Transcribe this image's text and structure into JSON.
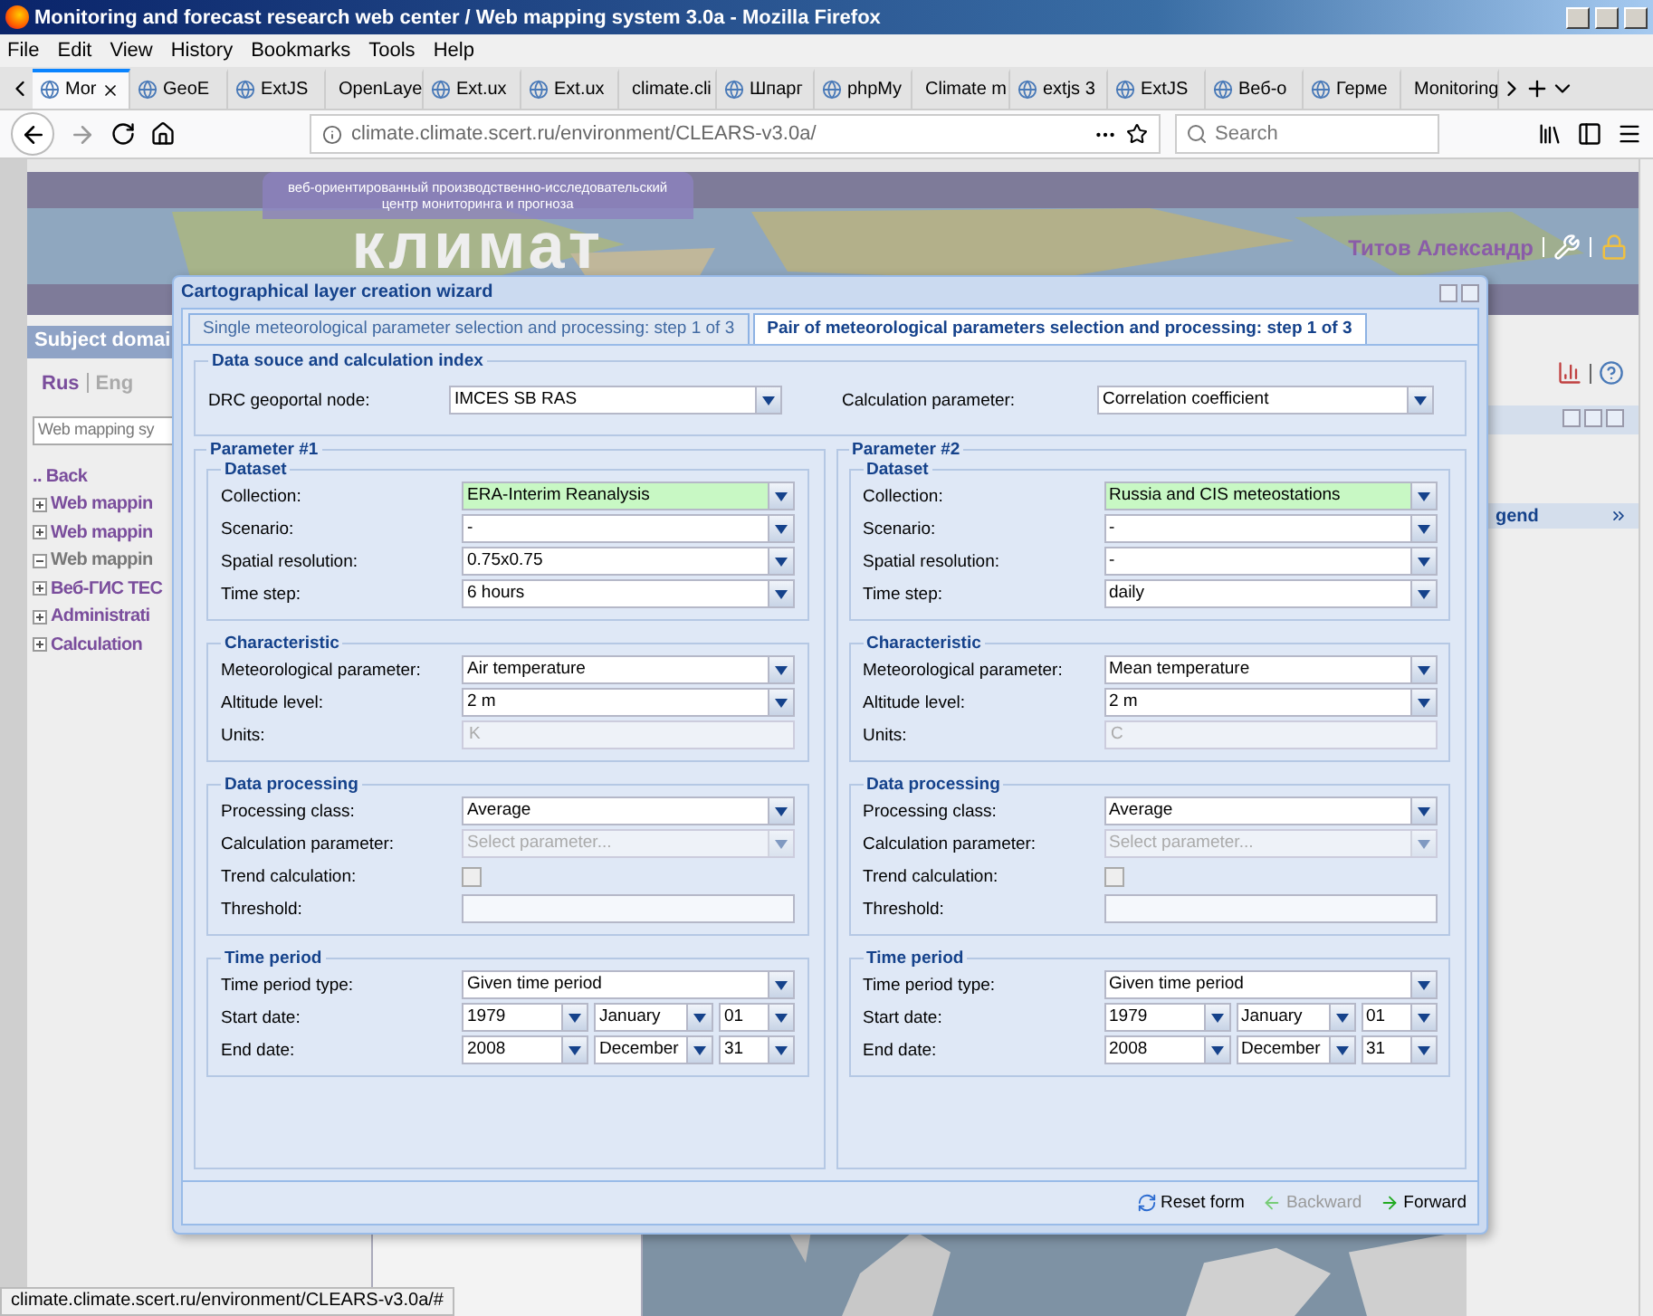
{
  "browser": {
    "title": "Monitoring and forecast research web center / Web mapping system 3.0a - Mozilla Firefox",
    "menu": [
      "File",
      "Edit",
      "View",
      "History",
      "Bookmarks",
      "Tools",
      "Help"
    ],
    "tabs": [
      {
        "label": "Mor",
        "selected": true
      },
      {
        "label": "GeoE",
        "selected": false
      },
      {
        "label": "ExtJS",
        "selected": false
      },
      {
        "label": "OpenLaye",
        "selected": false
      },
      {
        "label": "Ext.ux",
        "selected": false
      },
      {
        "label": "Ext.ux",
        "selected": false
      },
      {
        "label": "climate.cli",
        "selected": false
      },
      {
        "label": "Шпарг",
        "selected": false
      },
      {
        "label": "phpMy",
        "selected": false
      },
      {
        "label": "Climate m",
        "selected": false
      },
      {
        "label": "extjs 3",
        "selected": false
      },
      {
        "label": "ExtJS",
        "selected": false
      },
      {
        "label": "Веб-о",
        "selected": false
      },
      {
        "label": "Герме",
        "selected": false
      },
      {
        "label": "Monitoring",
        "selected": false
      }
    ],
    "url": "climate.climate.scert.ru/environment/CLEARS-v3.0a/",
    "search": {
      "placeholder": "Search"
    },
    "status": "climate.climate.scert.ru/environment/CLEARS-v3.0a/#"
  },
  "site": {
    "tagline": [
      "веб-ориентированный производственно-исследовательский",
      "центр мониторинга и прогноза"
    ],
    "logo": "климат",
    "user": "Титов Александр",
    "sidebar_title": "Subject domai",
    "languages": [
      {
        "label": "Rus",
        "selected": true
      },
      {
        "label": "Eng",
        "selected": false
      }
    ],
    "search_value": "Web mapping sy",
    "tree": [
      {
        "label": ".. Back",
        "kind": "back"
      },
      {
        "label": "Web mappin",
        "kind": "node",
        "expanded": false
      },
      {
        "label": "Web mappin",
        "kind": "node",
        "expanded": false
      },
      {
        "label": "Web mappin",
        "kind": "node",
        "expanded": true
      },
      {
        "label": "Веб-ГИС ТЕС",
        "kind": "node",
        "expanded": false
      },
      {
        "label": "Administrati",
        "kind": "node",
        "expanded": false
      },
      {
        "label": "Calculation",
        "kind": "node",
        "expanded": false
      }
    ],
    "legend_title": "gend"
  },
  "wizard": {
    "title": "Cartographical layer creation wizard",
    "tabs": [
      {
        "label": "Single meteorological parameter selection and processing: step 1 of 3",
        "selected": false
      },
      {
        "label": "Pair of meteorological parameters selection and processing: step 1 of 3",
        "selected": true
      }
    ],
    "source": {
      "title": "Data souce and calculation index",
      "fields": [
        {
          "label": "DRC geoportal node:",
          "value": "IMCES SB RAS"
        },
        {
          "label": "Calculation parameter:",
          "value": "Correlation coefficient"
        }
      ]
    },
    "parameters": [
      {
        "title": "Parameter #1",
        "sections": [
          {
            "title": "Dataset",
            "rows": [
              {
                "label": "Collection:",
                "kind": "select",
                "value": "ERA-Interim Reanalysis",
                "highlighted": true,
                "disabled": false
              },
              {
                "label": "Scenario:",
                "kind": "select",
                "value": "-",
                "highlighted": false,
                "disabled": false
              },
              {
                "label": "Spatial resolution:",
                "kind": "select",
                "value": "0.75x0.75",
                "highlighted": false,
                "disabled": false
              },
              {
                "label": "Time step:",
                "kind": "select",
                "value": "6 hours",
                "highlighted": false,
                "disabled": false
              }
            ]
          },
          {
            "title": "Characteristic",
            "rows": [
              {
                "label": "Meteorological parameter:",
                "kind": "select",
                "value": "Air temperature",
                "highlighted": false,
                "disabled": false
              },
              {
                "label": "Altitude level:",
                "kind": "select",
                "value": "2 m",
                "highlighted": false,
                "disabled": false
              },
              {
                "label": "Units:",
                "kind": "text",
                "value": "K",
                "disabled": true
              }
            ]
          },
          {
            "title": "Data processing",
            "rows": [
              {
                "label": "Processing class:",
                "kind": "select",
                "value": "Average",
                "highlighted": false,
                "disabled": false
              },
              {
                "label": "Calculation parameter:",
                "kind": "select",
                "placeholder": "Select parameter...",
                "highlighted": false,
                "disabled": true
              },
              {
                "label": "Trend calculation:",
                "kind": "checkbox",
                "checked": false
              },
              {
                "label": "Threshold:",
                "kind": "text",
                "disabled": false
              }
            ]
          },
          {
            "title": "Time period",
            "rows": [
              {
                "label": "Time period type:",
                "kind": "select",
                "value": "Given time period",
                "highlighted": false,
                "disabled": false
              },
              {
                "label": "Start date:",
                "kind": "date",
                "values": [
                  "1979",
                  "January",
                  "01"
                ]
              },
              {
                "label": "End date:",
                "kind": "date",
                "values": [
                  "2008",
                  "December",
                  "31"
                ]
              }
            ]
          }
        ]
      },
      {
        "title": "Parameter #2",
        "sections": [
          {
            "title": "Dataset",
            "rows": [
              {
                "label": "Collection:",
                "kind": "select",
                "value": "Russia and CIS meteostations",
                "highlighted": true,
                "disabled": false
              },
              {
                "label": "Scenario:",
                "kind": "select",
                "value": "-",
                "highlighted": false,
                "disabled": false
              },
              {
                "label": "Spatial resolution:",
                "kind": "select",
                "value": "-",
                "highlighted": false,
                "disabled": false
              },
              {
                "label": "Time step:",
                "kind": "select",
                "value": "daily",
                "highlighted": false,
                "disabled": false
              }
            ]
          },
          {
            "title": "Characteristic",
            "rows": [
              {
                "label": "Meteorological parameter:",
                "kind": "select",
                "value": "Mean temperature",
                "highlighted": false,
                "disabled": false
              },
              {
                "label": "Altitude level:",
                "kind": "select",
                "value": "2 m",
                "highlighted": false,
                "disabled": false
              },
              {
                "label": "Units:",
                "kind": "text",
                "value": "C",
                "disabled": true
              }
            ]
          },
          {
            "title": "Data processing",
            "rows": [
              {
                "label": "Processing class:",
                "kind": "select",
                "value": "Average",
                "highlighted": false,
                "disabled": false
              },
              {
                "label": "Calculation parameter:",
                "kind": "select",
                "placeholder": "Select parameter...",
                "highlighted": false,
                "disabled": true
              },
              {
                "label": "Trend calculation:",
                "kind": "checkbox",
                "checked": false
              },
              {
                "label": "Threshold:",
                "kind": "text",
                "disabled": false
              }
            ]
          },
          {
            "title": "Time period",
            "rows": [
              {
                "label": "Time period type:",
                "kind": "select",
                "value": "Given time period",
                "highlighted": false,
                "disabled": false
              },
              {
                "label": "Start date:",
                "kind": "date",
                "values": [
                  "1979",
                  "January",
                  "01"
                ]
              },
              {
                "label": "End date:",
                "kind": "date",
                "values": [
                  "2008",
                  "December",
                  "31"
                ]
              }
            ]
          }
        ]
      }
    ],
    "footer": [
      {
        "label": "Reset form",
        "kind": "reset",
        "disabled": false
      },
      {
        "label": "Backward",
        "kind": "back",
        "disabled": true
      },
      {
        "label": "Forward",
        "kind": "forward",
        "disabled": false
      }
    ]
  }
}
